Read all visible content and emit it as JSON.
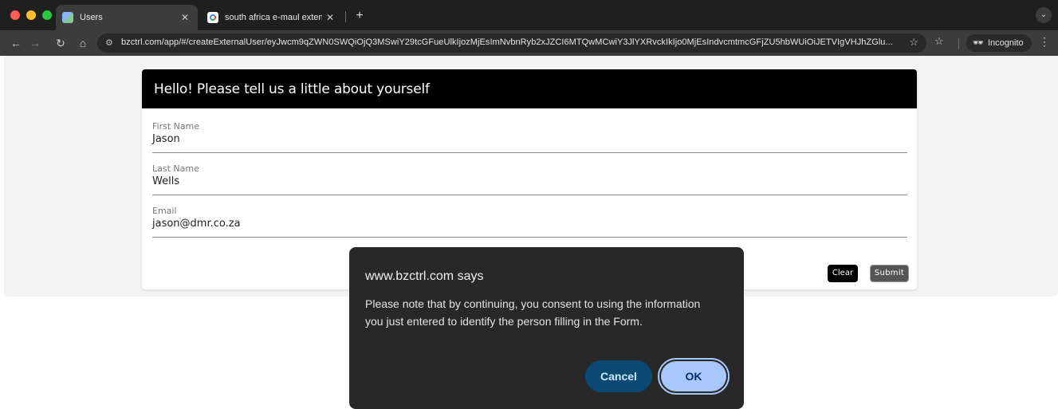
{
  "browser": {
    "tabs": [
      {
        "label": "Users",
        "active": true
      },
      {
        "label": "south africa e-maul extension",
        "active": false
      }
    ],
    "url": "bzctrl.com/app/#/createExternalUser/eyJwcm9qZWN0SWQiOjQ3MSwiY29tcGFueUlkIjozMjEsImNvbnRyb2xJZCI6MTQwMCwiY3JlYXRvckIkIjo0MjEsIndvcmtmcGFjZU5hbWUiOiJETVIgVHJhZGlu...",
    "incognito_label": "Incognito",
    "icons": {
      "back": "arrow-left-icon",
      "forward": "arrow-right-icon",
      "reload": "reload-icon",
      "home": "home-icon",
      "site_info": "tune-icon",
      "bookmark": "star-icon",
      "extensions": "extension-icon",
      "menu": "kebab-menu-icon"
    }
  },
  "form": {
    "header": "Hello! Please tell us a little about yourself",
    "fields": [
      {
        "label": "First Name",
        "value": "Jason"
      },
      {
        "label": "Last Name",
        "value": "Wells"
      },
      {
        "label": "Email",
        "value": "jason@dmr.co.za"
      }
    ],
    "clear_label": "Clear",
    "submit_label": "Submit"
  },
  "dialog": {
    "title": "www.bzctrl.com says",
    "message": "Please note that by continuing, you consent to using the information you just entered to identify the person filling in the Form.",
    "cancel_label": "Cancel",
    "ok_label": "OK"
  },
  "colors": {
    "header_bg": "#000000",
    "dialog_bg": "#282828",
    "ok_button": "#a8c7fa",
    "cancel_button": "#0b4a73"
  }
}
